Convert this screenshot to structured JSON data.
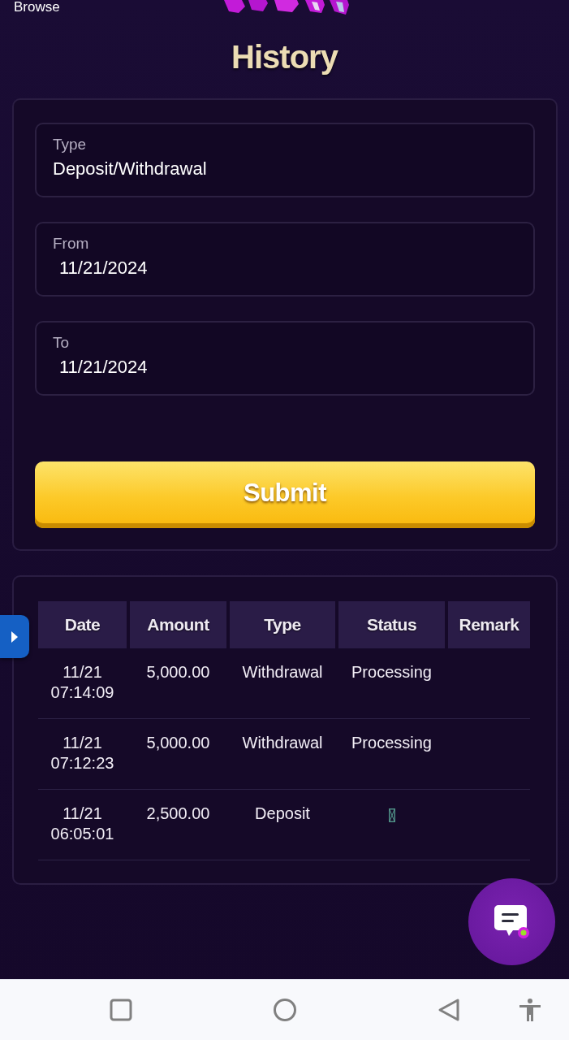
{
  "top_bar": {
    "label": "Browse"
  },
  "title": "History",
  "filters": [
    {
      "kind": "select",
      "label": "Type",
      "value": "Deposit/Withdrawal"
    },
    {
      "kind": "date",
      "label": "From",
      "value": "11/21/2024"
    },
    {
      "kind": "date",
      "label": "To",
      "value": "11/21/2024"
    }
  ],
  "submit_button": "Submit",
  "table": {
    "columns": [
      "Date",
      "Amount",
      "Type",
      "Status",
      "Remark"
    ],
    "rows": [
      {
        "date": "11/21",
        "time": "07:14:09",
        "amount": "5,000.00",
        "type": "Withdrawal",
        "status": "Processing"
      },
      {
        "date": "11/21",
        "time": "07:12:23",
        "amount": "5,000.00",
        "type": "Withdrawal",
        "status": "Processing"
      },
      {
        "date": "11/21",
        "time": "06:05:01",
        "amount": "2,500.00",
        "type": "Deposit"
      }
    ]
  }
}
